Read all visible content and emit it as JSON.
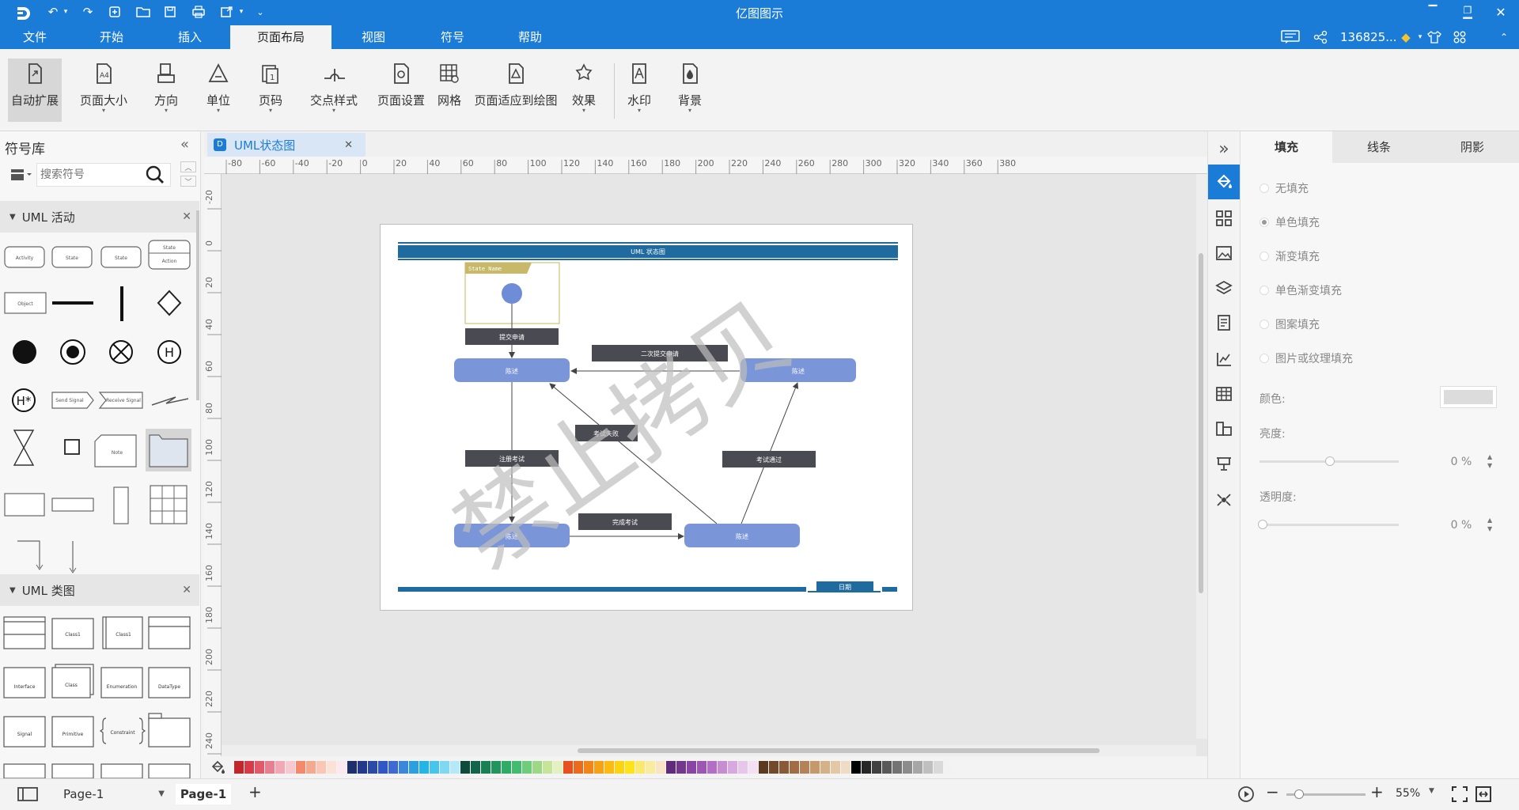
{
  "app": {
    "title": "亿图图示",
    "user": "136825..."
  },
  "menu": [
    "文件",
    "开始",
    "插入",
    "页面布局",
    "视图",
    "符号",
    "帮助"
  ],
  "ribbon": [
    {
      "label": "自动扩展",
      "icon": "auto-expand-icon"
    },
    {
      "label": "页面大小",
      "icon": "page-size-icon"
    },
    {
      "label": "方向",
      "icon": "orientation-icon"
    },
    {
      "label": "单位",
      "icon": "unit-icon"
    },
    {
      "label": "页码",
      "icon": "page-number-icon"
    },
    {
      "label": "交点样式",
      "icon": "jump-style-icon"
    },
    {
      "label": "页面设置",
      "icon": "page-setup-icon"
    },
    {
      "label": "网格",
      "icon": "grid-icon"
    },
    {
      "label": "页面适应到绘图",
      "icon": "fit-to-drawing-icon"
    },
    {
      "label": "效果",
      "icon": "effect-icon"
    },
    {
      "label": "水印",
      "icon": "watermark-icon"
    },
    {
      "label": "背景",
      "icon": "background-icon"
    }
  ],
  "library": {
    "title": "符号库",
    "search_placeholder": "搜索符号",
    "section1": "UML 活动",
    "section2": "UML 类图",
    "activity_shapes": {
      "activity": "Activity",
      "state1": "State",
      "state2": "State",
      "state3": "State",
      "action": "Action",
      "object": "Object",
      "send": "Send Signal",
      "receive": "Receive Signal",
      "note": "Note"
    },
    "class_shapes": {
      "class1": "Class1",
      "class2": "Class1",
      "interface": "Interface",
      "enumeration": "Enumeration",
      "datatype": "DataType",
      "class3": "Class",
      "signal": "Signal",
      "primitive": "Primitive",
      "constraint": "Constraint"
    }
  },
  "doc_tab": {
    "label": "UML状态图"
  },
  "ruler_top": [
    "-80",
    "-60",
    "-40",
    "-20",
    "0",
    "20",
    "40",
    "60",
    "80",
    "100",
    "120",
    "140",
    "160",
    "180",
    "200",
    "220",
    "240",
    "260",
    "280",
    "300",
    "320",
    "340",
    "360",
    "380"
  ],
  "ruler_left": [
    "-20",
    "0",
    "20",
    "40",
    "60",
    "80",
    "100",
    "120",
    "140",
    "160",
    "180",
    "200",
    "220",
    "240"
  ],
  "diagram": {
    "title": "UML 状态图",
    "state_name": "State Name",
    "labels": {
      "submit": "提交申请",
      "second_submit": "二次提交申请",
      "fail": "考试失败",
      "register": "注册考试",
      "pass": "考试通过",
      "complete": "完成考试",
      "date": "日期"
    },
    "states": {
      "s1": "陈述",
      "s2": "陈述",
      "s3": "陈述",
      "s4": "陈述"
    },
    "watermark": "禁止拷贝"
  },
  "props": {
    "tabs": [
      "填充",
      "线条",
      "阴影"
    ],
    "fill_options": [
      "无填充",
      "单色填充",
      "渐变填充",
      "单色渐变填充",
      "图案填充",
      "图片或纹理填充"
    ],
    "color_label": "颜色:",
    "brightness_label": "亮度:",
    "brightness_value": "0 %",
    "transparency_label": "透明度:",
    "transparency_value": "0 %"
  },
  "palette": [
    "#c0272d",
    "#d83a47",
    "#e05a6a",
    "#e87e8f",
    "#f0a8b4",
    "#f7c8cf",
    "#f48a6c",
    "#f5a98f",
    "#f8c7b5",
    "#fbe1d6",
    "#fce9ef",
    "#1e2f6e",
    "#233a8a",
    "#2a4aa8",
    "#3157c4",
    "#3e6ad6",
    "#3b88d8",
    "#2aa0e0",
    "#25b4e4",
    "#46c6ec",
    "#7fd8f2",
    "#b5e8f8",
    "#0f4b3a",
    "#11664a",
    "#1a7f55",
    "#22955f",
    "#2fab66",
    "#42bd6e",
    "#6fcc7a",
    "#9bd986",
    "#c7e59a",
    "#e3f0c0",
    "#e5521e",
    "#ec6a1c",
    "#f28518",
    "#f7a215",
    "#fbbb12",
    "#fdd20f",
    "#fde31c",
    "#fbe96d",
    "#f8ed9e",
    "#f8e5c6",
    "#5e2c7a",
    "#74378f",
    "#8a44a3",
    "#9e56b4",
    "#b36fc4",
    "#c78dd2",
    "#d8a9df",
    "#e6c6e9",
    "#f3e1f3",
    "#5b3a1e",
    "#72492a",
    "#8a5a36",
    "#a06d44",
    "#b48256",
    "#c6996c",
    "#d6b188",
    "#e3c8a6",
    "#eedcc4",
    "#000000",
    "#262626",
    "#404040",
    "#595959",
    "#737373",
    "#8c8c8c",
    "#a6a6a6",
    "#bfbfbf",
    "#d9d9d9",
    "#f2f2f2"
  ],
  "status": {
    "page_select": "Page-1",
    "page_tab": "Page-1",
    "zoom": "55%"
  }
}
